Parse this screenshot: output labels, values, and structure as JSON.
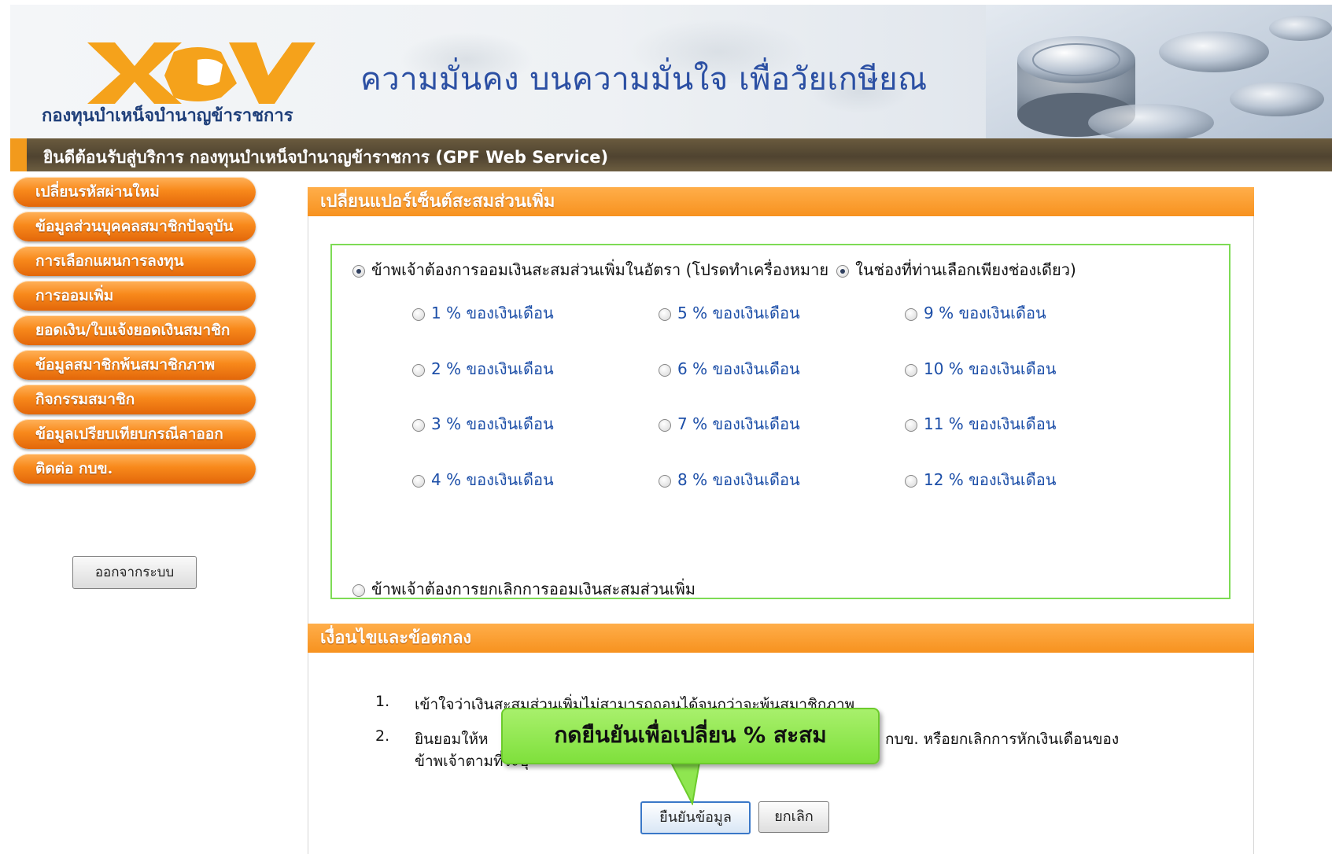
{
  "header": {
    "logo_text": "กองทุนบำเหน็จบำนาญข้าราชการ",
    "slogan": "ความมั่นคง บนความมั่นใจ เพื่อวัยเกษียณ",
    "welcome": "ยินดีต้อนรับสู่บริการ กองทุนบำเหน็จบำนาญข้าราชการ (GPF Web Service)"
  },
  "sidebar": {
    "items": [
      {
        "label": "เปลี่ยนรหัสผ่านใหม่"
      },
      {
        "label": "ข้อมูลส่วนบุคคลสมาชิกปัจจุบัน"
      },
      {
        "label": "การเลือกแผนการลงทุน"
      },
      {
        "label": "การออมเพิ่ม"
      },
      {
        "label": "ยอดเงิน/ใบแจ้งยอดเงินสมาชิก"
      },
      {
        "label": "ข้อมูลสมาชิกพ้นสมาชิกภาพ"
      },
      {
        "label": "กิจกรรมสมาชิก"
      },
      {
        "label": "ข้อมูลเปรียบเทียบกรณีลาออก"
      },
      {
        "label": "ติดต่อ กบข."
      }
    ],
    "logout_label": "ออกจากระบบ"
  },
  "main": {
    "section1_title": "เปลี่ยนแปอร์เซ็นต์สะสมส่วนเพิ่ม",
    "option_increase_label_a": "ข้าพเจ้าต้องการออมเงินสะสมส่วนเพิ่มในอัตรา (โปรดทำเครื่องหมาย",
    "option_increase_label_b": "ในช่องที่ท่านเลือกเพียงช่องเดียว)",
    "percent_options": [
      "1 % ของเงินเดือน",
      "2 % ของเงินเดือน",
      "3 % ของเงินเดือน",
      "4 % ของเงินเดือน",
      "5 % ของเงินเดือน",
      "6 % ของเงินเดือน",
      "7 % ของเงินเดือน",
      "8 % ของเงินเดือน",
      "9 % ของเงินเดือน",
      "10 % ของเงินเดือน",
      "11 % ของเงินเดือน",
      "12 % ของเงินเดือน"
    ],
    "option_cancel_label": "ข้าพเจ้าต้องการยกเลิกการออมเงินสะสมส่วนเพิ่ม",
    "section2_title": "เงื่อนไขและข้อตกลง",
    "terms": [
      {
        "num": "1.",
        "text": "เข้าใจว่าเงินสะสมส่วนเพิ่มไม่สามารถถอนได้จนกว่าจะพ้นสมาชิกภาพ"
      },
      {
        "num": "2.",
        "text_line1": "ยินยอมให้หักเงินเดือนเพื่อส่งเข้า กบข. หรือยกเลิกการหักเงินเดือนของ",
        "text_line1_visible_end": "กบข. หรือยกเลิกการหักเงินเดือนของ",
        "text_line1_visible_start": "ยินยอมให้ห",
        "text_line2": "ข้าพเจ้าตามที่ระบุ"
      }
    ],
    "confirm_label": "ยืนยันข้อมูล",
    "cancel_label": "ยกเลิก"
  },
  "callout": {
    "text": "กดยืนยันเพื่อเปลี่ยน  % สะสม"
  },
  "colors": {
    "accent_orange": "#f7921f",
    "header_brown": "#4f4330",
    "callout_green": "#8fe650",
    "box_green": "#7edb55",
    "option_blue": "#1d4fa8"
  }
}
